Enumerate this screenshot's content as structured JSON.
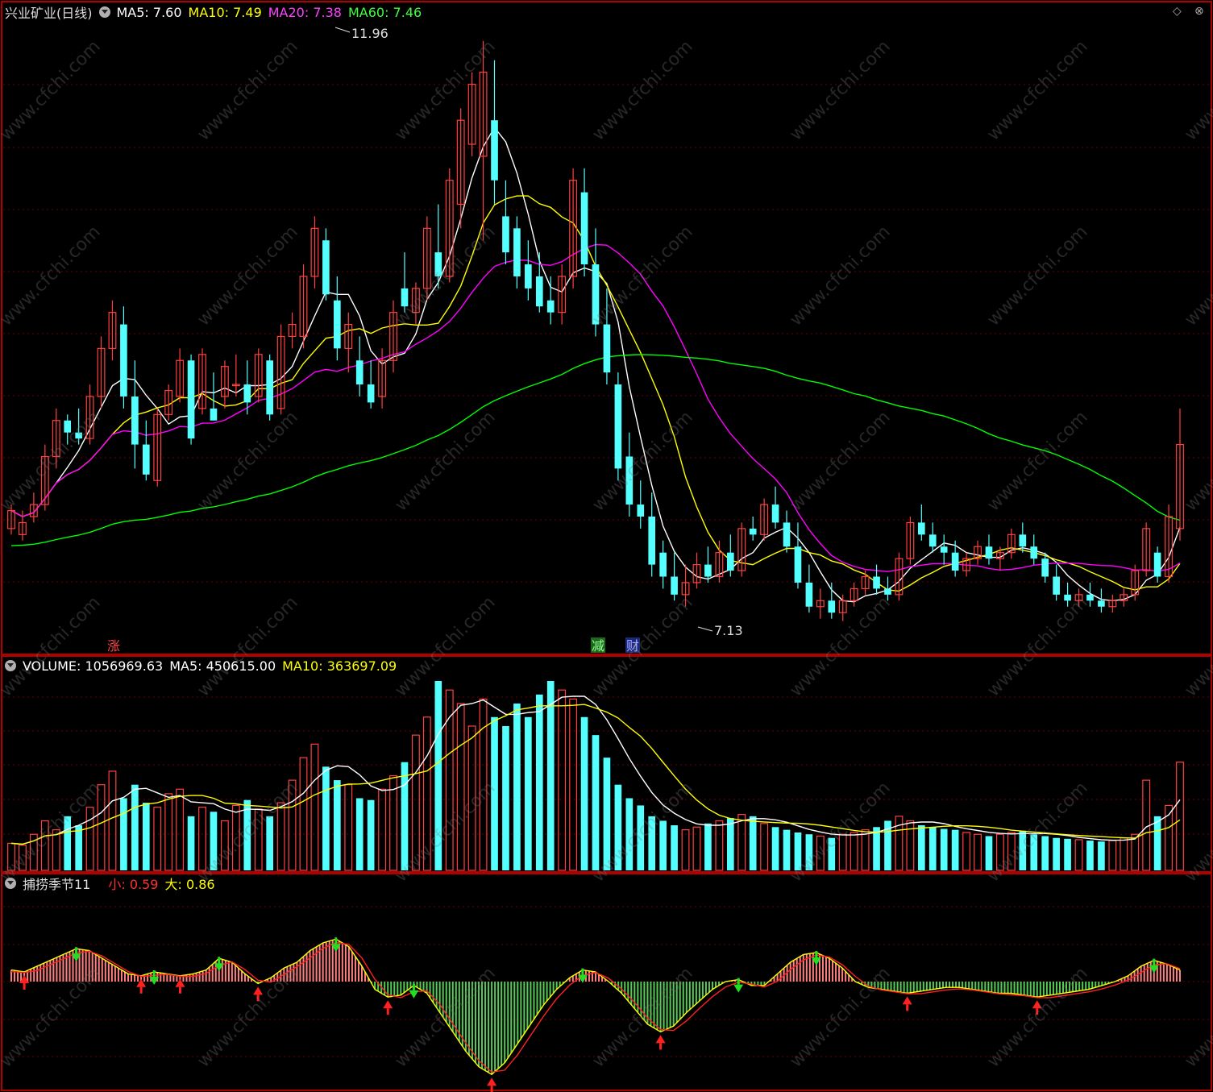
{
  "price_panel": {
    "title": "兴业矿业(日线)",
    "ma5_label": "MA5: 7.60",
    "ma10_label": "MA10: 7.49",
    "ma20_label": "MA20: 7.38",
    "ma60_label": "MA60: 7.46",
    "high_label": "11.96",
    "low_label": "7.13",
    "event_up": "涨",
    "event_cut": "减",
    "event_cai": "财"
  },
  "volume_panel": {
    "volume_label": "VOLUME: 1056969.63",
    "ma5_label": "MA5: 450615.00",
    "ma10_label": "MA10: 363697.09"
  },
  "indicator_panel": {
    "title": "捕捞季节11",
    "small_label": "小: 0.59",
    "big_label": "大: 0.86"
  },
  "watermark": "www.cfchi.com",
  "colors": {
    "up": "#ff4040",
    "down": "#54ffff",
    "ma5": "#ffffff",
    "ma10": "#ffff00",
    "ma20": "#ff00ff",
    "ma60": "#00ff00",
    "osc_pos": "#ff8080",
    "osc_neg": "#55cc55"
  },
  "chart_data": [
    {
      "type": "candlestick",
      "title": "兴业矿业(日线)",
      "ylim": [
        7.0,
        12.1
      ],
      "series": [
        {
          "name": "MA5",
          "values": []
        },
        {
          "name": "MA10",
          "values": []
        },
        {
          "name": "MA20",
          "values": []
        },
        {
          "name": "MA60",
          "values": []
        }
      ],
      "ohlc": [
        [
          7.9,
          8.1,
          7.85,
          8.05
        ],
        [
          7.85,
          8.05,
          7.8,
          7.95
        ],
        [
          8.0,
          8.2,
          7.95,
          8.1
        ],
        [
          8.1,
          8.6,
          8.05,
          8.5
        ],
        [
          8.5,
          8.9,
          8.4,
          8.8
        ],
        [
          8.8,
          8.85,
          8.6,
          8.7
        ],
        [
          8.7,
          8.9,
          8.6,
          8.65
        ],
        [
          8.65,
          9.1,
          8.6,
          9.0
        ],
        [
          9.0,
          9.5,
          8.9,
          9.4
        ],
        [
          9.4,
          9.8,
          9.3,
          9.7
        ],
        [
          9.6,
          9.75,
          8.9,
          9.0
        ],
        [
          9.0,
          9.3,
          8.4,
          8.6
        ],
        [
          8.6,
          8.8,
          8.3,
          8.35
        ],
        [
          8.3,
          8.9,
          8.25,
          8.85
        ],
        [
          8.85,
          9.1,
          8.8,
          9.05
        ],
        [
          9.0,
          9.4,
          8.95,
          9.3
        ],
        [
          9.3,
          9.35,
          8.6,
          8.65
        ],
        [
          8.9,
          9.4,
          8.85,
          9.35
        ],
        [
          8.9,
          9.2,
          8.8,
          8.8
        ],
        [
          9.0,
          9.3,
          8.9,
          9.25
        ],
        [
          9.1,
          9.35,
          9.0,
          9.1
        ],
        [
          9.1,
          9.3,
          8.85,
          8.95
        ],
        [
          9.0,
          9.4,
          8.95,
          9.35
        ],
        [
          9.3,
          9.35,
          8.8,
          8.85
        ],
        [
          8.9,
          9.6,
          8.85,
          9.5
        ],
        [
          9.5,
          9.7,
          9.4,
          9.6
        ],
        [
          9.5,
          10.1,
          9.4,
          10.0
        ],
        [
          10.0,
          10.5,
          9.9,
          10.4
        ],
        [
          10.3,
          10.4,
          9.8,
          9.85
        ],
        [
          9.8,
          10.0,
          9.3,
          9.4
        ],
        [
          9.4,
          9.7,
          9.2,
          9.6
        ],
        [
          9.3,
          9.5,
          9.0,
          9.1
        ],
        [
          9.1,
          9.3,
          8.9,
          8.95
        ],
        [
          9.0,
          9.4,
          8.9,
          9.3
        ],
        [
          9.3,
          9.8,
          9.2,
          9.7
        ],
        [
          9.9,
          10.2,
          9.7,
          9.75
        ],
        [
          9.7,
          9.95,
          9.6,
          9.9
        ],
        [
          9.9,
          10.5,
          9.8,
          10.4
        ],
        [
          10.2,
          10.6,
          9.9,
          10.0
        ],
        [
          10.0,
          10.9,
          9.95,
          10.8
        ],
        [
          10.6,
          11.4,
          10.4,
          11.3
        ],
        [
          11.1,
          11.7,
          11.0,
          11.6
        ],
        [
          11.0,
          11.96,
          10.3,
          11.7
        ],
        [
          11.3,
          11.8,
          10.6,
          10.8
        ],
        [
          10.5,
          10.8,
          10.1,
          10.2
        ],
        [
          10.4,
          10.5,
          9.9,
          10.0
        ],
        [
          10.1,
          10.3,
          9.8,
          9.9
        ],
        [
          10.0,
          10.2,
          9.7,
          9.75
        ],
        [
          9.8,
          10.0,
          9.6,
          9.7
        ],
        [
          9.7,
          10.1,
          9.6,
          10.0
        ],
        [
          10.0,
          10.9,
          9.9,
          10.8
        ],
        [
          10.7,
          10.9,
          10.0,
          10.1
        ],
        [
          10.1,
          10.4,
          9.5,
          9.6
        ],
        [
          9.6,
          9.9,
          9.1,
          9.2
        ],
        [
          9.1,
          9.2,
          8.3,
          8.4
        ],
        [
          8.5,
          8.7,
          8.0,
          8.1
        ],
        [
          8.1,
          8.3,
          7.9,
          8.0
        ],
        [
          8.0,
          8.2,
          7.5,
          7.6
        ],
        [
          7.7,
          7.8,
          7.4,
          7.5
        ],
        [
          7.5,
          7.7,
          7.3,
          7.35
        ],
        [
          7.35,
          7.6,
          7.25,
          7.45
        ],
        [
          7.45,
          7.7,
          7.4,
          7.6
        ],
        [
          7.6,
          7.75,
          7.45,
          7.5
        ],
        [
          7.5,
          7.8,
          7.45,
          7.7
        ],
        [
          7.7,
          7.85,
          7.5,
          7.55
        ],
        [
          7.55,
          7.95,
          7.5,
          7.9
        ],
        [
          7.9,
          8.0,
          7.8,
          7.85
        ],
        [
          7.85,
          8.15,
          7.8,
          8.1
        ],
        [
          8.1,
          8.25,
          7.9,
          7.95
        ],
        [
          7.95,
          8.05,
          7.7,
          7.75
        ],
        [
          7.75,
          7.95,
          7.4,
          7.45
        ],
        [
          7.45,
          7.6,
          7.2,
          7.25
        ],
        [
          7.25,
          7.4,
          7.15,
          7.3
        ],
        [
          7.3,
          7.45,
          7.15,
          7.2
        ],
        [
          7.2,
          7.35,
          7.13,
          7.3
        ],
        [
          7.3,
          7.45,
          7.25,
          7.4
        ],
        [
          7.4,
          7.55,
          7.35,
          7.5
        ],
        [
          7.5,
          7.6,
          7.35,
          7.4
        ],
        [
          7.4,
          7.5,
          7.3,
          7.35
        ],
        [
          7.35,
          7.7,
          7.3,
          7.65
        ],
        [
          7.65,
          8.0,
          7.6,
          7.95
        ],
        [
          7.95,
          8.1,
          7.8,
          7.85
        ],
        [
          7.85,
          7.95,
          7.7,
          7.75
        ],
        [
          7.75,
          7.85,
          7.6,
          7.7
        ],
        [
          7.7,
          7.8,
          7.5,
          7.55
        ],
        [
          7.55,
          7.7,
          7.5,
          7.65
        ],
        [
          7.65,
          7.8,
          7.6,
          7.75
        ],
        [
          7.75,
          7.85,
          7.6,
          7.65
        ],
        [
          7.65,
          7.75,
          7.55,
          7.7
        ],
        [
          7.7,
          7.9,
          7.65,
          7.85
        ],
        [
          7.85,
          7.95,
          7.7,
          7.75
        ],
        [
          7.75,
          7.85,
          7.6,
          7.65
        ],
        [
          7.65,
          7.7,
          7.45,
          7.5
        ],
        [
          7.5,
          7.6,
          7.3,
          7.35
        ],
        [
          7.35,
          7.45,
          7.25,
          7.3
        ],
        [
          7.3,
          7.4,
          7.25,
          7.35
        ],
        [
          7.35,
          7.45,
          7.25,
          7.3
        ],
        [
          7.3,
          7.4,
          7.2,
          7.25
        ],
        [
          7.25,
          7.35,
          7.2,
          7.3
        ],
        [
          7.3,
          7.4,
          7.25,
          7.35
        ],
        [
          7.35,
          7.6,
          7.3,
          7.55
        ],
        [
          7.55,
          7.95,
          7.5,
          7.9
        ],
        [
          7.7,
          7.75,
          7.45,
          7.5
        ],
        [
          7.5,
          8.1,
          7.45,
          8.0
        ],
        [
          7.9,
          8.9,
          7.8,
          8.6
        ]
      ]
    },
    {
      "type": "bar",
      "title": "VOLUME",
      "values": [
        30,
        28,
        40,
        55,
        45,
        60,
        50,
        70,
        95,
        110,
        80,
        95,
        75,
        70,
        85,
        90,
        60,
        70,
        65,
        55,
        72,
        78,
        68,
        60,
        75,
        100,
        125,
        140,
        115,
        100,
        95,
        80,
        78,
        90,
        105,
        120,
        150,
        170,
        210,
        200,
        185,
        160,
        190,
        170,
        160,
        185,
        170,
        195,
        210,
        200,
        190,
        170,
        150,
        125,
        95,
        80,
        72,
        60,
        55,
        50,
        45,
        48,
        52,
        55,
        58,
        62,
        60,
        52,
        48,
        45,
        42,
        40,
        38,
        36,
        40,
        42,
        45,
        48,
        55,
        60,
        55,
        50,
        48,
        46,
        45,
        42,
        40,
        38,
        40,
        42,
        44,
        40,
        38,
        36,
        35,
        34,
        33,
        32,
        33,
        36,
        40,
        100,
        60,
        72,
        120
      ]
    },
    {
      "type": "bar",
      "title": "捕捞季节11",
      "series": [
        {
          "name": "小",
          "values": []
        },
        {
          "name": "大",
          "values": []
        }
      ],
      "values": [
        0.3,
        0.25,
        0.4,
        0.55,
        0.7,
        0.85,
        0.8,
        0.6,
        0.4,
        0.2,
        0.15,
        0.25,
        0.2,
        0.15,
        0.2,
        0.3,
        0.6,
        0.5,
        0.2,
        -0.05,
        0.1,
        0.35,
        0.5,
        0.8,
        1.0,
        1.1,
        0.9,
        0.4,
        -0.2,
        -0.4,
        -0.35,
        -0.1,
        -0.3,
        -0.8,
        -1.3,
        -1.8,
        -2.2,
        -2.4,
        -2.1,
        -1.6,
        -1.1,
        -0.6,
        -0.2,
        0.1,
        0.3,
        0.25,
        0.0,
        -0.3,
        -0.7,
        -1.1,
        -1.3,
        -1.15,
        -0.8,
        -0.5,
        -0.2,
        0.0,
        0.05,
        -0.1,
        -0.1,
        0.2,
        0.5,
        0.7,
        0.75,
        0.6,
        0.35,
        0.0,
        -0.15,
        -0.2,
        -0.25,
        -0.3,
        -0.25,
        -0.2,
        -0.15,
        -0.15,
        -0.2,
        -0.25,
        -0.3,
        -0.3,
        -0.35,
        -0.4,
        -0.35,
        -0.3,
        -0.25,
        -0.2,
        -0.1,
        0.0,
        0.15,
        0.4,
        0.55,
        0.45,
        0.3
      ]
    }
  ]
}
